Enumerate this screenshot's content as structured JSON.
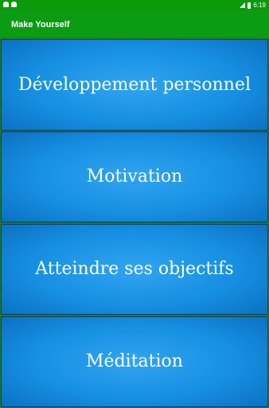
{
  "status_bar": {
    "time": "6:19",
    "icons": [
      "android-icon",
      "android-icon",
      "signal-icon",
      "battery-icon"
    ]
  },
  "app_bar": {
    "title": "Make Yourself"
  },
  "menu": {
    "items": [
      {
        "label": "Développement personnel"
      },
      {
        "label": "Motivation"
      },
      {
        "label": "Atteindre ses objectifs"
      },
      {
        "label": "Méditation"
      }
    ]
  },
  "colors": {
    "app_bar": "#0b9c13",
    "status_bar": "#0a9a0a",
    "button_center": "#31a4f0",
    "button_edge": "#0b6fc0",
    "background": "#1e7d2a"
  }
}
